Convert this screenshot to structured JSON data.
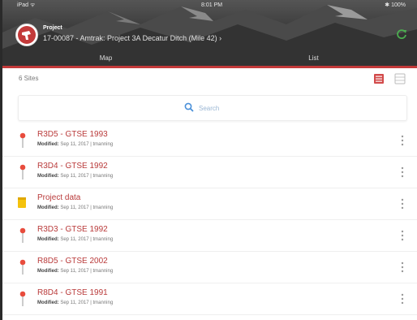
{
  "status_bar": {
    "left": "iPad ᯤ",
    "time": "8:01 PM",
    "right": "✱ 100%"
  },
  "project": {
    "label": "Project",
    "name": "17-00087 - Amtrak: Project 3A Decatur Ditch (Mile 42) ›"
  },
  "tabs": [
    {
      "label": "Map"
    },
    {
      "label": "List"
    }
  ],
  "colors": {
    "accent": "#c33a3a",
    "title_red": "#b93a3a",
    "pin_red": "#e84c3d",
    "folder_yellow": "#f4c20d",
    "search_blue": "#4a90d9",
    "refresh_green": "#4caf50"
  },
  "toolbar": {
    "sites_label": "6 Sites"
  },
  "search": {
    "placeholder": "Search",
    "value": ""
  },
  "sites": [
    {
      "title": "R3D5 - GTSE 1993",
      "modified_label": "Modified:",
      "modified": "Sep 11, 2017 | tmanning",
      "icon": "pin-icon"
    },
    {
      "title": "R3D4 - GTSE 1992",
      "modified_label": "Modified:",
      "modified": "Sep 11, 2017 | tmanning",
      "icon": "pin-icon"
    },
    {
      "title": "Project data",
      "modified_label": "Modified:",
      "modified": "Sep 11, 2017 | tmanning",
      "icon": "folder-icon"
    },
    {
      "title": "R3D3 - GTSE 1992",
      "modified_label": "Modified:",
      "modified": "Sep 11, 2017 | tmanning",
      "icon": "pin-icon"
    },
    {
      "title": "R8D5 - GTSE 2002",
      "modified_label": "Modified:",
      "modified": "Sep 11, 2017 | tmanning",
      "icon": "pin-icon"
    },
    {
      "title": "R8D4 - GTSE 1991",
      "modified_label": "Modified:",
      "modified": "Sep 11, 2017 | tmanning",
      "icon": "pin-icon"
    }
  ]
}
